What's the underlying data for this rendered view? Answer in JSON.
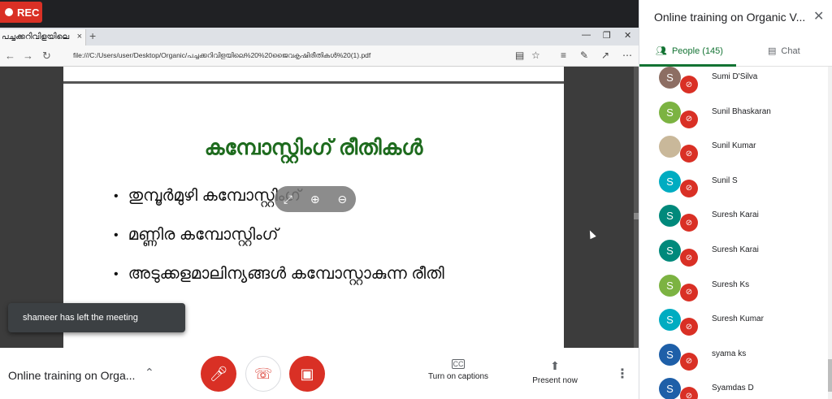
{
  "recording": {
    "label": "REC"
  },
  "browser": {
    "tab_title": "പച്ചക്കറിവിളയിലെ",
    "tab_close": "×",
    "new_tab": "+",
    "url": "file:///C:/Users/user/Desktop/Organic/പച്ചക്കറിവിളയിലെ%20%20ജൈവകൃഷിരീതികൾ%20(1).pdf"
  },
  "slide": {
    "title": "കമ്പോസ്റ്റിംഗ് രീതികൾ",
    "bullets": [
      "തുമ്പൂർമുഴി കമ്പോസ്റ്റിംഗ്",
      "മണ്ണിര കമ്പോസ്റ്റിംഗ്",
      "അടുക്കളമാലിന്യങ്ങൾ കമ്പോസ്റ്റാകുന്ന രീതി"
    ]
  },
  "toast": {
    "text": "shameer has left the meeting"
  },
  "controls": {
    "meeting_name": "Online training on Orga...",
    "captions_label": "Turn on captions",
    "present_label": "Present now",
    "cc_icon": "CC"
  },
  "panel": {
    "title": "Online training on Organic V...",
    "people_tab": "People (145)",
    "chat_tab": "Chat",
    "participants": [
      {
        "initial": "S",
        "name": "Sumi D'Silva",
        "color": "#8d6e63"
      },
      {
        "initial": "S",
        "name": "Sunil Bhaskaran",
        "color": "#7cb342"
      },
      {
        "initial": "",
        "name": "Sunil Kumar",
        "color": "#c9b89a"
      },
      {
        "initial": "S",
        "name": "Sunil S",
        "color": "#00acc1"
      },
      {
        "initial": "S",
        "name": "Suresh Karai",
        "color": "#00897b"
      },
      {
        "initial": "S",
        "name": "Suresh Karai",
        "color": "#00897b"
      },
      {
        "initial": "S",
        "name": "Suresh Ks",
        "color": "#7cb342"
      },
      {
        "initial": "S",
        "name": "Suresh Kumar",
        "color": "#00acc1"
      },
      {
        "initial": "S",
        "name": "syama ks",
        "color": "#1e5fa8"
      },
      {
        "initial": "S",
        "name": "Syamdas D",
        "color": "#1e5fa8"
      }
    ]
  }
}
